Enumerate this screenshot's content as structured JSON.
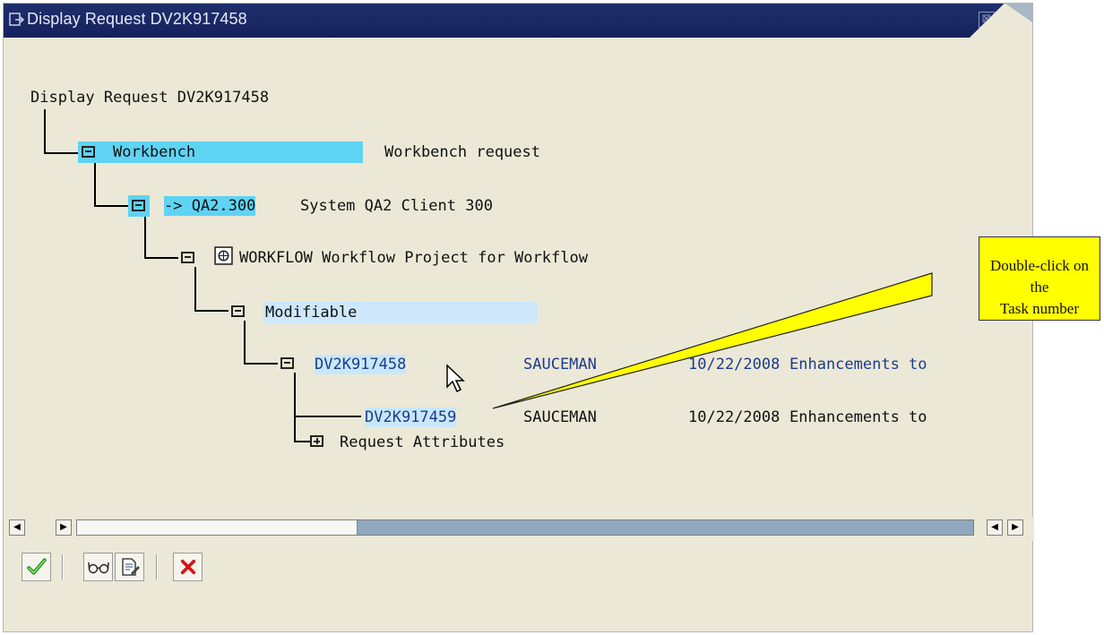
{
  "window": {
    "title": "Display Request DV2K917458",
    "close_glyph": "⊠"
  },
  "tree": {
    "root": "Display Request DV2K917458",
    "workbench": {
      "label": "Workbench",
      "desc": "Workbench request"
    },
    "target": {
      "label": "-> QA2.300",
      "desc": "System QA2 Client 300"
    },
    "project": {
      "label": "WORKFLOW Workflow Project for Workflow"
    },
    "status": {
      "label": "Modifiable"
    },
    "request": {
      "id": "DV2K917458",
      "owner": "SAUCEMAN",
      "date": "10/22/2008",
      "desc": "Enhancements to"
    },
    "task": {
      "id": "DV2K917459",
      "owner": "SAUCEMAN",
      "date": "10/22/2008",
      "desc": "Enhancements to"
    },
    "attributes": {
      "label": "Request Attributes"
    }
  },
  "scrollbar": {
    "left_arrow": "◀",
    "right_arrow": "▶"
  },
  "toolbar": {
    "icons": [
      "check-icon",
      "glasses-icon",
      "document-edit-icon",
      "cancel-icon"
    ]
  },
  "callout": {
    "text_line1": "Double-click on the",
    "text_line2": "Task number"
  },
  "colors": {
    "title_bar": "#1f2f6c",
    "highlight_strong": "#5fd3f4",
    "highlight_light": "#c9e7fb",
    "callout_bg": "#ffff00",
    "text_blue": "#1b3c8b"
  }
}
